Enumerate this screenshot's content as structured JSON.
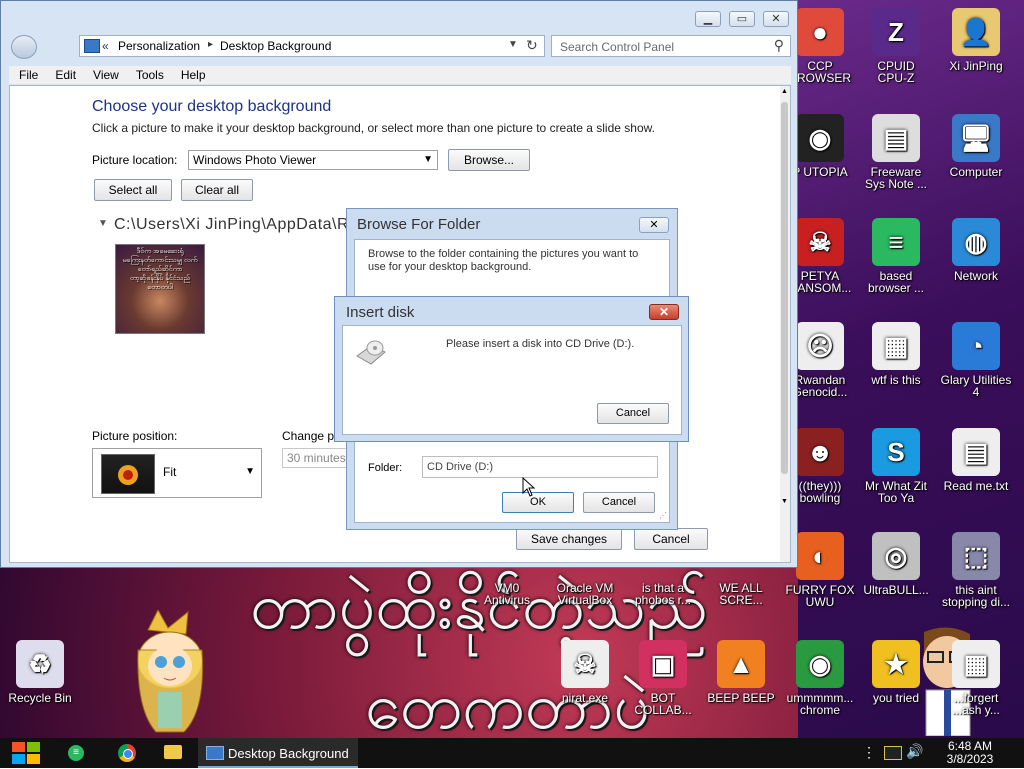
{
  "desktop": {
    "wallpaper_text_line1": "တာပွဲထိုးနိုင်တဲ့သည်",
    "wallpaper_text_line2": "တေကတာပဲ",
    "icons": [
      {
        "label": "CCP\nBROWSER",
        "glyph": "●",
        "color": "#e04a3a"
      },
      {
        "label": "CPUID\nCPU-Z",
        "glyph": "Z",
        "color": "#5a2a8a"
      },
      {
        "label": "Xi JinPing",
        "glyph": "👤",
        "color": "#e8c870"
      },
      {
        "label": "P UTOPIA",
        "glyph": "◉",
        "color": "#222"
      },
      {
        "label": "Freeware\nSys Note ...",
        "glyph": "▤",
        "color": "#ddd"
      },
      {
        "label": "Computer",
        "glyph": "🖥",
        "color": "#3a78c8"
      },
      {
        "label": "PETYA\nRANSOM...",
        "glyph": "☠",
        "color": "#c82020"
      },
      {
        "label": "based\nbrowser ...",
        "glyph": "≡",
        "color": "#2ab860"
      },
      {
        "label": "Network",
        "glyph": "◍",
        "color": "#2a8ad8"
      },
      {
        "label": "Rwandan\nGenocid...",
        "glyph": "☹",
        "color": "#eee"
      },
      {
        "label": "wtf is this",
        "glyph": "▦",
        "color": "#eee"
      },
      {
        "label": "Glary Utilities\n4",
        "glyph": "◔",
        "color": "#2a7ad8"
      },
      {
        "label": "((they)))\nbowling",
        "glyph": "☻",
        "color": "#8a2020"
      },
      {
        "label": "Mr What Zit\nToo Ya",
        "glyph": "S",
        "color": "#1a9ae0"
      },
      {
        "label": "Read me.txt",
        "glyph": "▤",
        "color": "#eee"
      },
      {
        "label": "FURRY FOX\nUWU",
        "glyph": "◐",
        "color": "#e86020"
      },
      {
        "label": "UltraBULL...",
        "glyph": "◎",
        "color": "#c0c0c0"
      },
      {
        "label": "this aint\nstopping di...",
        "glyph": "⬚",
        "color": "#88a"
      },
      {
        "label": "VM0\nAntivirus",
        "glyph": "",
        "color": "transparent"
      },
      {
        "label": "Oracle VM\nVirtualBox",
        "glyph": "",
        "color": "transparent"
      },
      {
        "label": "is that a\nphobos r...",
        "glyph": "",
        "color": "transparent"
      },
      {
        "label": "WE ALL\nSCRE...",
        "glyph": "",
        "color": "transparent"
      },
      {
        "label": "nirat.exe",
        "glyph": "☠",
        "color": "#eee"
      },
      {
        "label": "BOT\nCOLLAB...",
        "glyph": "▣",
        "color": "#d23060"
      },
      {
        "label": "BEEP BEEP",
        "glyph": "▲",
        "color": "#f08020"
      },
      {
        "label": "ummmmm...\nchrome",
        "glyph": "◉",
        "color": "#2a9a40"
      },
      {
        "label": "you tried",
        "glyph": "★",
        "color": "#f0c020"
      },
      {
        "label": "...forgert\n...ash y...",
        "glyph": "▦",
        "color": "#eee"
      },
      {
        "label": "Recycle Bin",
        "glyph": "♻",
        "color": "#dde"
      }
    ]
  },
  "window": {
    "breadcrumb_root": "Personalization",
    "breadcrumb_page": "Desktop Background",
    "search_placeholder": "Search Control Panel",
    "menu": [
      "File",
      "Edit",
      "View",
      "Tools",
      "Help"
    ],
    "heading": "Choose your desktop background",
    "subheading": "Click a picture to make it your desktop background, or select more than one picture to create a slide show.",
    "picture_location_label": "Picture location:",
    "picture_location_value": "Windows Photo Viewer",
    "browse_label": "Browse...",
    "select_all_label": "Select all",
    "clear_all_label": "Clear all",
    "folder_path": "C:\\Users\\Xi JinPing\\AppData\\Ro",
    "thumb_caption": "ဒီဝ်က အမေဆေးရုံ\nမကြေးနတ်ကောင်းသမျှ လက်\nတော်ရည်ဆိုင်ကာ\nတာ့ဆိုဖန်းနှိပ် နိုင်ငံသည်\nတောတပါ",
    "picture_position_label": "Picture position:",
    "picture_position_value": "Fit",
    "change_picture_label": "Change p",
    "change_picture_value": "30 minutes",
    "save_label": "Save changes",
    "cancel_label": "Cancel"
  },
  "browse_dialog": {
    "title": "Browse For Folder",
    "description": "Browse to the folder containing the pictures you want to use for your desktop background.",
    "folder_label": "Folder:",
    "folder_value": "CD Drive (D:)",
    "ok_label": "OK",
    "cancel_label": "Cancel"
  },
  "insert_dialog": {
    "title": "Insert disk",
    "message": "Please insert a disk into CD Drive (D:).",
    "cancel_label": "Cancel"
  },
  "taskbar": {
    "active_window": "Desktop Background",
    "time": "6:48 AM",
    "date": "3/8/2023"
  }
}
